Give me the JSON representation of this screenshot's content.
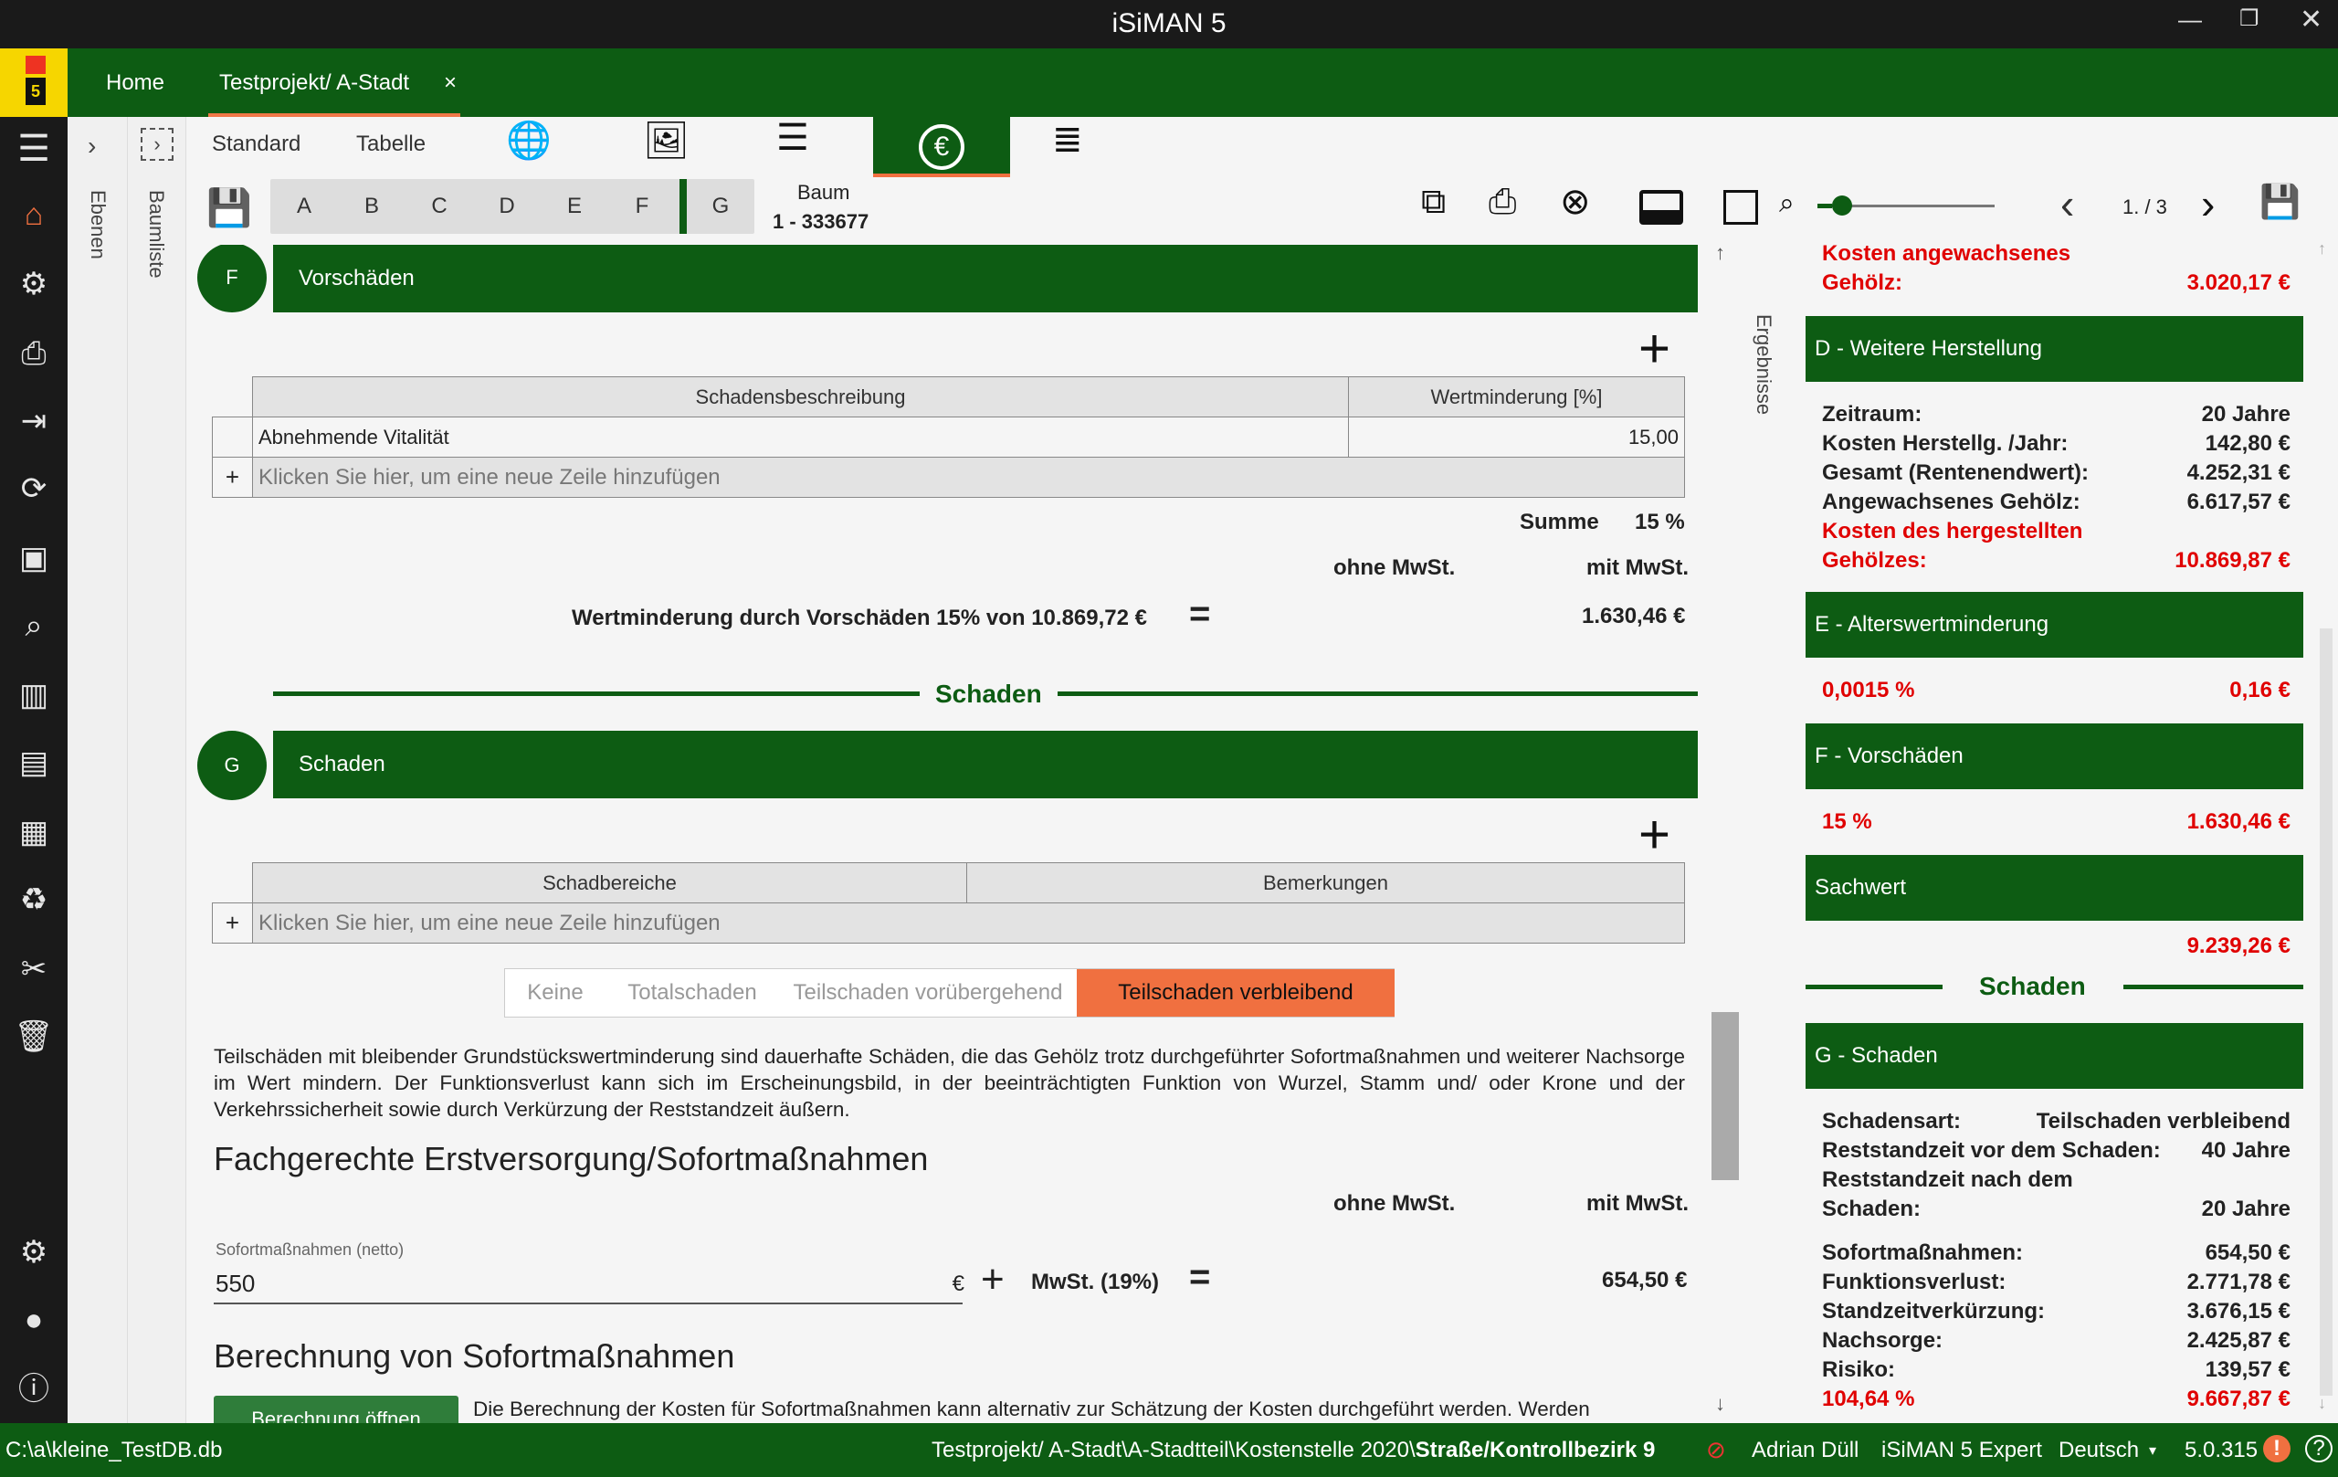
{
  "window": {
    "title": "iSiMAN 5"
  },
  "tabs": [
    {
      "label": "Home"
    },
    {
      "label": "Testprojekt/ A-Stadt"
    }
  ],
  "tab_close": "×",
  "logo_text": "5",
  "sidebar_strips": {
    "ebenen": "Ebenen",
    "baumliste": "Baumliste",
    "ergebnisse": "Ergebnisse"
  },
  "toolbar": {
    "view_standard": "Standard",
    "view_tabelle": "Tabelle",
    "sections": [
      "A",
      "B",
      "C",
      "D",
      "E",
      "F",
      "G"
    ],
    "baum_label": "Baum",
    "baum_id": "1 - 333677",
    "page": "1. / 3",
    "zoom_level": 0.08
  },
  "vorschaeden": {
    "badge": "F",
    "title": "Vorschäden",
    "table": {
      "headers": [
        "Schadensbeschreibung",
        "Wertminderung [%]"
      ],
      "rows": [
        {
          "desc": "Abnehmende Vitalität",
          "value": "15,00"
        }
      ],
      "add_row": "Klicken Sie hier, um eine neue Zeile hinzufügen",
      "add_icon": "+"
    },
    "summe_label": "Summe",
    "summe_value": "15 %",
    "ohne_mwst": "ohne MwSt.",
    "mit_mwst": "mit MwSt.",
    "wertminderung_label": "Wertminderung durch Vorschäden 15% von 10.869,72 €",
    "equals": "=",
    "wertminderung_value": "1.630,46 €"
  },
  "schaden_divider": "Schaden",
  "schaden": {
    "badge": "G",
    "title": "Schaden",
    "table": {
      "headers": [
        "Schadbereiche",
        "Bemerkungen"
      ],
      "add_row": "Klicken Sie hier, um eine neue Zeile hinzufügen",
      "add_icon": "+"
    },
    "types": [
      "Keine",
      "Totalschaden",
      "Teilschaden vorübergehend",
      "Teilschaden verbleibend"
    ],
    "selected_type": "Teilschaden verbleibend",
    "description": "Teilschäden mit bleibender Grundstückswertminderung sind dauerhafte Schäden, die das Gehölz trotz durchgeführter Sofortmaßnahmen und weiterer Nachsorge im Wert mindern. Der Funktionsverlust kann sich im Erscheinungsbild, in der beeinträchtigten Funktion von Wurzel, Stamm und/ oder Krone und der Verkehrssicherheit sowie durch Verkürzung der Reststandzeit äußern.",
    "erstversorgung_title": "Fachgerechte Erstversorgung/Sofortmaßnahmen",
    "ohne_mwst": "ohne MwSt.",
    "mit_mwst": "mit MwSt.",
    "sofort_field_label": "Sofortmaßnahmen (netto)",
    "sofort_value": "550",
    "currency": "€",
    "plus": "+",
    "mwst_label": "MwSt. (19%)",
    "equals": "=",
    "sofort_result": "654,50 €",
    "berechnung_title": "Berechnung von Sofortmaßnahmen",
    "berechnung_button": "Berechnung öffnen",
    "berechnung_text": "Die Berechnung der Kosten für Sofortmaßnahmen kann alternativ zur Schätzung der Kosten durchgeführt werden. Werden"
  },
  "results": {
    "top_label_1": "Kosten angewachsenes",
    "top_label_2": "Gehölz:",
    "top_value": "3.020,17 €",
    "d_header": "D - Weitere Herstellung",
    "d_rows": [
      {
        "label": "Zeitraum:",
        "value": "20 Jahre"
      },
      {
        "label": "Kosten Herstellg. /Jahr:",
        "value": "142,80 €"
      },
      {
        "label": "Gesamt (Rentenendwert):",
        "value": "4.252,31 €"
      },
      {
        "label": "Angewachsenes Gehölz:",
        "value": "6.617,57 €"
      }
    ],
    "d_total_label_1": "Kosten des hergestellten",
    "d_total_label_2": "Gehölzes:",
    "d_total_value": "10.869,87 €",
    "e_header": "E - Alterswertminderung",
    "e_percent": "0,0015 %",
    "e_value": "0,16 €",
    "f_header": "F - Vorschäden",
    "f_percent": "15 %",
    "f_value": "1.630,46 €",
    "sachwert_header": "Sachwert",
    "sachwert_value": "9.239,26 €",
    "schaden_divider": "Schaden",
    "g_header": "G - Schaden",
    "schadensart_label": "Schadensart:",
    "schadensart_value": "Teilschaden verbleibend",
    "rest_vor_label": "Reststandzeit vor dem Schaden:",
    "rest_vor_value": "40 Jahre",
    "rest_nach_label_1": "Reststandzeit nach dem",
    "rest_nach_label_2": "Schaden:",
    "rest_nach_value": "20 Jahre",
    "g_rows": [
      {
        "label": "Sofortmaßnahmen:",
        "value": "654,50 €"
      },
      {
        "label": "Funktionsverlust:",
        "value": "2.771,78 €"
      },
      {
        "label": "Standzeitverkürzung:",
        "value": "3.676,15 €"
      },
      {
        "label": "Nachsorge:",
        "value": "2.425,87 €"
      },
      {
        "label": "Risiko:",
        "value": "139,57 €"
      }
    ],
    "g_total_percent": "104,64 %",
    "g_total_value": "9.667,87 €"
  },
  "statusbar": {
    "db_path": "C:\\a\\kleine_TestDB.db",
    "breadcrumb_prefix": "Testprojekt/ A-Stadt\\A-Stadtteil\\Kostenstelle 2020\\",
    "breadcrumb_bold": "Straße/Kontrollbezirk 9",
    "user": "Adrian Düll",
    "edition": "iSiMAN 5 Expert",
    "language": "Deutsch",
    "version": "5.0.315"
  },
  "colors": {
    "accent_green": "#0d5c13",
    "accent_orange": "#f07040",
    "alert_red": "#e00000"
  }
}
